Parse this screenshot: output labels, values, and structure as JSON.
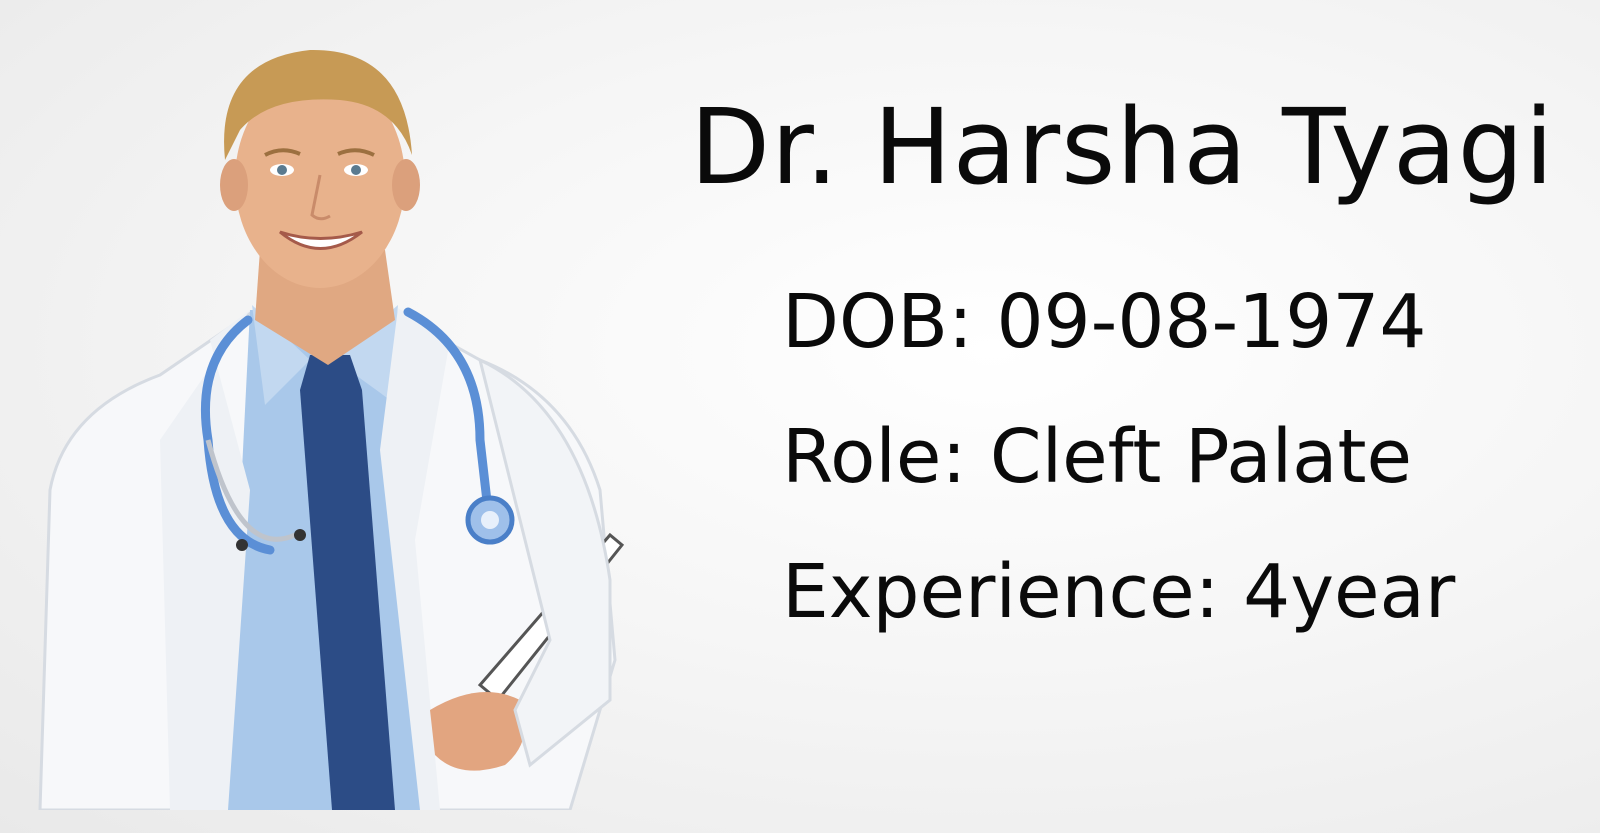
{
  "profile": {
    "name": "Dr. Harsha Tyagi",
    "dob": "DOB: 09-08-1974",
    "role": "Role: Cleft Palate",
    "experience": "Experience: 4year"
  },
  "colors": {
    "text": "#0a0a0a",
    "coat": "#f7f8fa",
    "shirt": "#a9c8ea",
    "tie": "#2c4c86",
    "stethoscope": "#5b8fd6",
    "hair": "#c79a55",
    "skin": "#e8b28c"
  },
  "icons": {
    "portrait": "doctor-portrait-photo"
  }
}
